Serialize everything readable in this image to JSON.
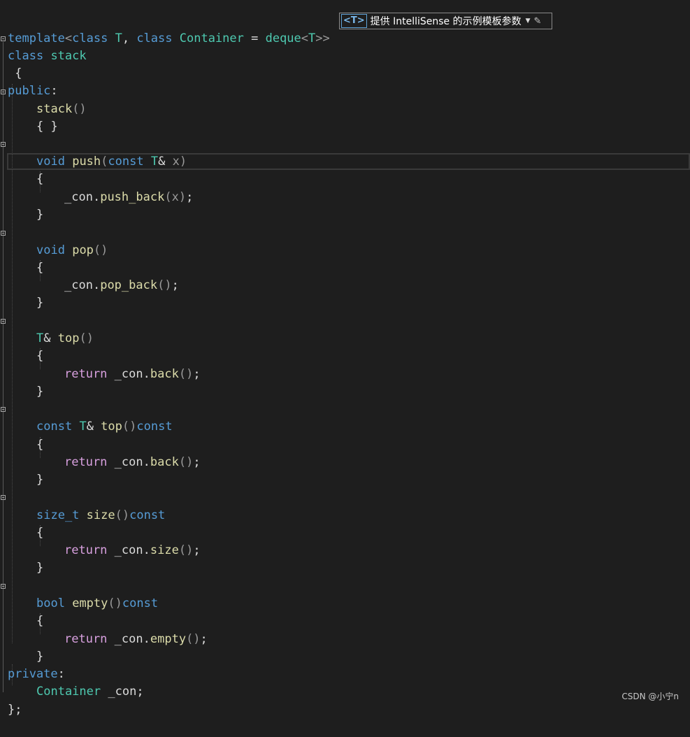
{
  "template_bar": {
    "tag": "<T>",
    "label": "提供 IntelliSense 的示例模板参数"
  },
  "watermark": "CSDN @小宁n",
  "tokens": {
    "template": "template",
    "class": "class",
    "public": "public",
    "private": "private",
    "void": "void",
    "const": "const",
    "return": "return",
    "bool": "bool",
    "size_t": "size_t",
    "T": "T",
    "Container": "Container",
    "deque": "deque",
    "stack": "stack",
    "push": "push",
    "pop": "pop",
    "top": "top",
    "size": "size",
    "empty": "empty",
    "push_back": "push_back",
    "pop_back": "pop_back",
    "back": "back",
    "con": "_con",
    "x": "x"
  }
}
